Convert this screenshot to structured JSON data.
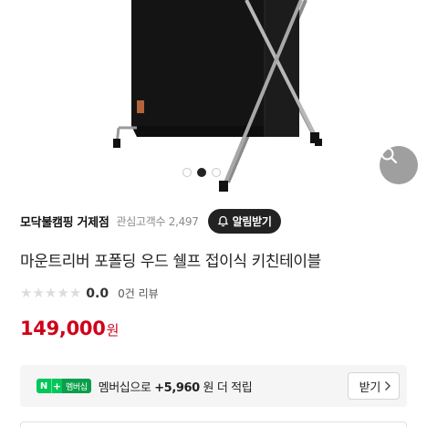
{
  "product_image": {
    "subject": "folding kitchen shelf",
    "carousel_total": 3,
    "carousel_active": 1
  },
  "zoom_button": {
    "icon": "magnifier-icon"
  },
  "store": {
    "name": "모닥불캠핑 거제점",
    "fav_label": "관심고객수 2,497",
    "alarm_label": "알림받기"
  },
  "product": {
    "title": "마운트리버 포폴딩 우드 쉘프 접이식 키친테이블",
    "rating": "0.0",
    "rating_stars": 0,
    "review_count": "0건 리뷰",
    "price": "149,000",
    "currency": "원",
    "price_color": "#d0021b"
  },
  "membership": {
    "badge_n": "N",
    "badge_plus": "+",
    "badge_label": "멤버십",
    "text_prefix": "멤버십으로",
    "points": "+5,960",
    "text_suffix": "원 더 적립",
    "button_label": "받기"
  }
}
